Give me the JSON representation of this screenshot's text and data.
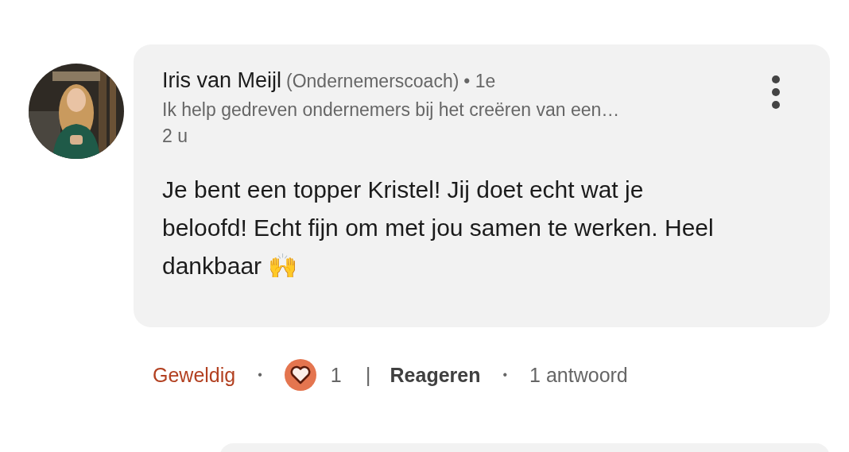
{
  "comment": {
    "author": "Iris van Meijl",
    "role": "(Ondernemerscoach)",
    "degree": "• 1e",
    "headline": "Ik help gedreven ondernemers bij het creëren van een…",
    "time": "2 u",
    "body": "Je bent een topper Kristel! Jij doet echt wat je beloofd! Echt fijn om met jou samen te werken. Heel dankbaar 🙌"
  },
  "actions": {
    "reaction": {
      "label": "Geweldig",
      "selected": true
    },
    "separator_1": "•",
    "reaction_count": "1",
    "separator_2": "|",
    "reply": "Reageren",
    "separator_3": "•",
    "replies": "1 antwoord"
  }
}
